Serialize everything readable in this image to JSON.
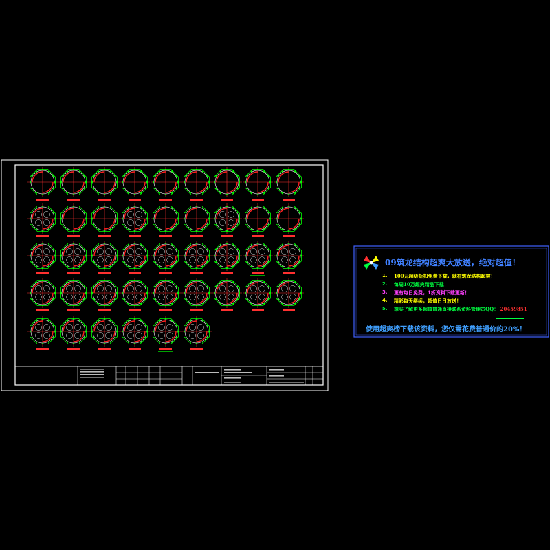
{
  "colors": {
    "background": "#000000",
    "frame": "#ffffff",
    "circle": "#e8e8e8",
    "rebar": "#00ff00",
    "section": "#ff2020",
    "label": "#ff3030",
    "ad_border": "#4060ff",
    "ad_title": "#4080ff",
    "ad_yellow": "#ffff00",
    "ad_green": "#00ff40",
    "ad_magenta": "#ff40ff",
    "ad_red": "#ff3030",
    "ad_footer": "#40a0ff"
  },
  "drawing": {
    "rows": [
      9,
      9,
      9,
      9,
      6
    ],
    "underlined_labels": [
      [
        2,
        7
      ],
      [
        4,
        4
      ]
    ]
  },
  "advertisement": {
    "logo": "pinwheel-logo",
    "title": "09筑龙结构超爽大放送，绝对超值！",
    "items": [
      {
        "num": "1.",
        "text": "100元超级折扣免费下载，就在筑龙结构超爽！",
        "color": "#ffff00"
      },
      {
        "num": "2.",
        "text": "每周10万超爽精品下载！",
        "color": "#00ff40"
      },
      {
        "num": "3.",
        "text": "更有每日免费，1折资料下载更新！",
        "color": "#ff40ff"
      },
      {
        "num": "4.",
        "text": "精彩每天继续，超值日日放送！",
        "color": "#ffff00"
      },
      {
        "num": "5.",
        "text": "想买了解更多超值普通直接联系资料管理员QQ：",
        "extra": "20459851",
        "color": "#00ff40"
      }
    ],
    "footer": "使用超爽榜下载该资料，您仅需花费普通价的20%！"
  }
}
